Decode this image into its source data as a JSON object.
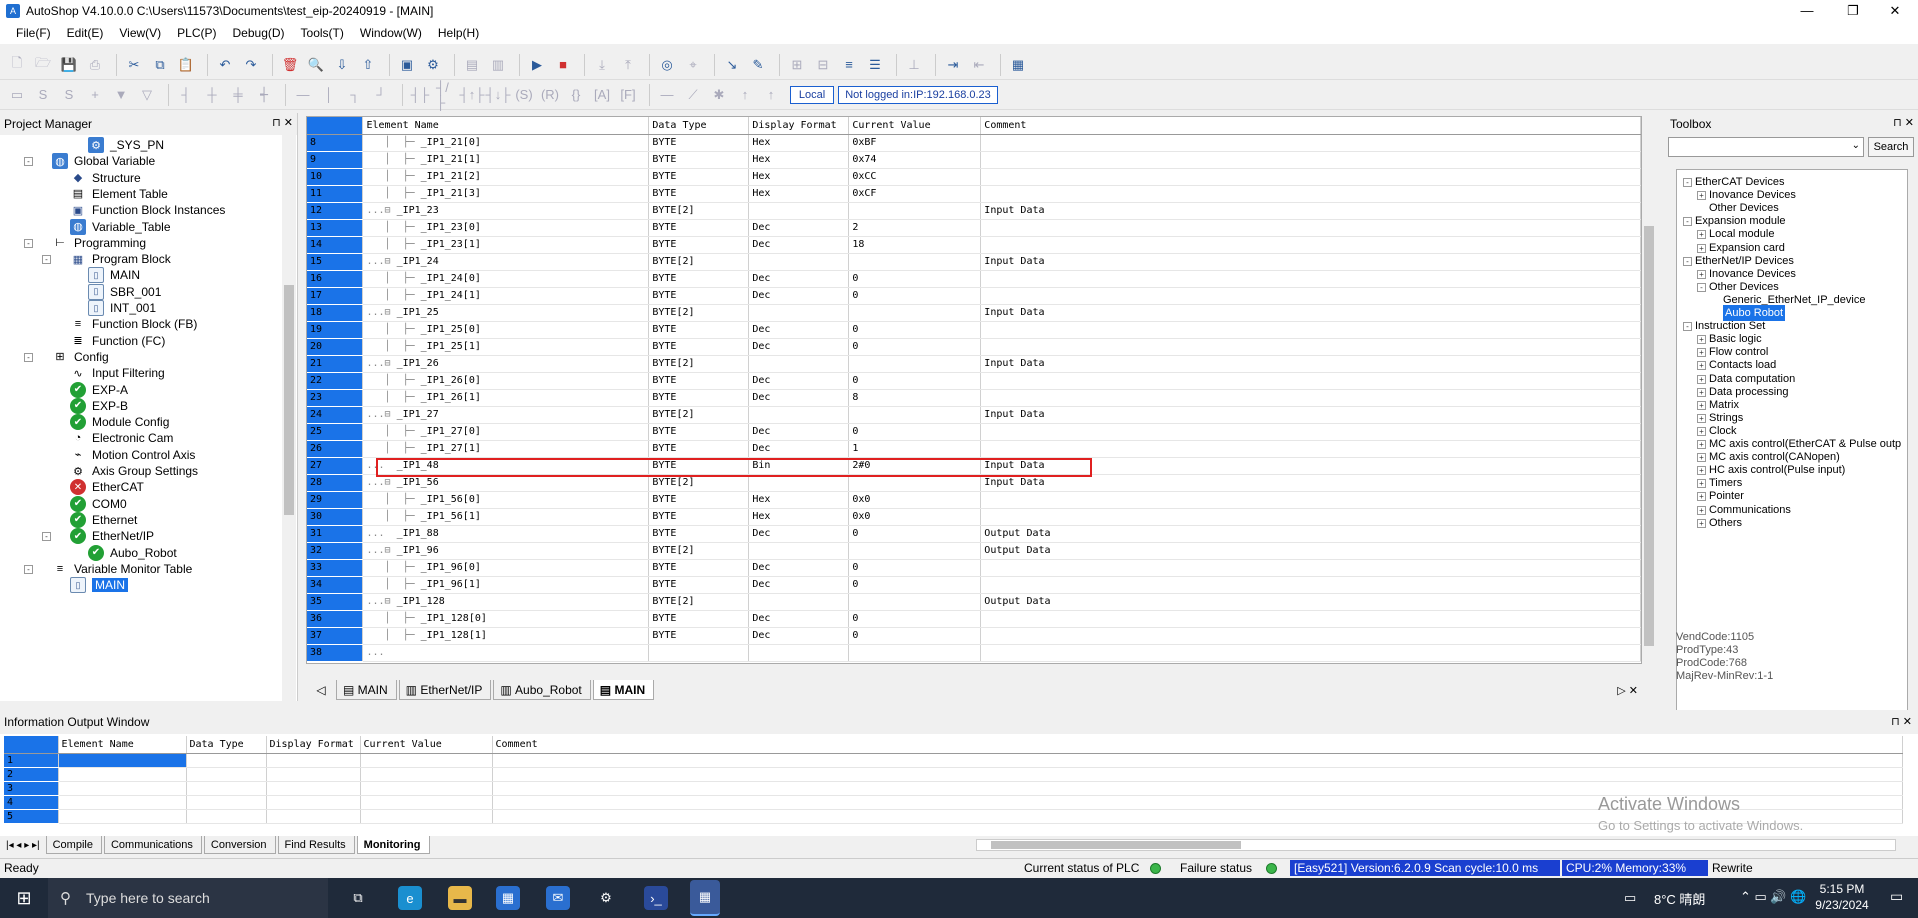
{
  "window": {
    "title": "AutoShop V4.10.0.0  C:\\Users\\11573\\Documents\\test_eip-20240919 - [MAIN]"
  },
  "menu": [
    "File(F)",
    "Edit(E)",
    "View(V)",
    "PLC(P)",
    "Debug(D)",
    "Tools(T)",
    "Window(W)",
    "Help(H)"
  ],
  "toolbar": {
    "local_label": "Local",
    "login_status": "Not logged in:IP:192.168.0.23"
  },
  "project_manager": {
    "title": "Project Manager",
    "items": [
      {
        "label": "_SYS_PN",
        "icon": "gear-blue-icon",
        "level": 3
      },
      {
        "label": "Global Variable",
        "icon": "globe-icon",
        "level": 1,
        "expander": "-"
      },
      {
        "label": "Structure",
        "icon": "structure-icon",
        "level": 2
      },
      {
        "label": "Element Table",
        "icon": "table-icon",
        "level": 2
      },
      {
        "label": "Function Block Instances",
        "icon": "cube-icon",
        "level": 2
      },
      {
        "label": "Variable_Table",
        "icon": "globe-icon",
        "level": 2
      },
      {
        "label": "Programming",
        "icon": "programming-icon",
        "level": 1,
        "expander": "-"
      },
      {
        "label": "Program Block",
        "icon": "grid-icon",
        "level": 2,
        "expander": "-"
      },
      {
        "label": "MAIN",
        "icon": "doc-icon",
        "level": 3
      },
      {
        "label": "SBR_001",
        "icon": "doc-icon",
        "level": 3
      },
      {
        "label": "INT_001",
        "icon": "doc-icon",
        "level": 3
      },
      {
        "label": "Function Block (FB)",
        "icon": "fb-icon",
        "level": 2
      },
      {
        "label": "Function (FC)",
        "icon": "fc-icon",
        "level": 2
      },
      {
        "label": "Config",
        "icon": "config-icon",
        "level": 1,
        "expander": "-"
      },
      {
        "label": "Input Filtering",
        "icon": "filter-icon",
        "level": 2
      },
      {
        "label": "EXP-A",
        "icon": "check-icon",
        "level": 2
      },
      {
        "label": "EXP-B",
        "icon": "check-icon",
        "level": 2
      },
      {
        "label": "Module Config",
        "icon": "check-icon",
        "level": 2
      },
      {
        "label": "Electronic Cam",
        "icon": "cam-icon",
        "level": 2
      },
      {
        "label": "Motion Control Axis",
        "icon": "axis-icon",
        "level": 2
      },
      {
        "label": "Axis Group Settings",
        "icon": "gear-icon",
        "level": 2
      },
      {
        "label": "EtherCAT",
        "icon": "error-icon",
        "level": 2
      },
      {
        "label": "COM0",
        "icon": "check-icon",
        "level": 2
      },
      {
        "label": "Ethernet",
        "icon": "check-icon",
        "level": 2
      },
      {
        "label": "EtherNet/IP",
        "icon": "check-icon",
        "level": 2,
        "expander": "-"
      },
      {
        "label": "Aubo_Robot",
        "icon": "check-icon",
        "level": 3
      },
      {
        "label": "Variable Monitor Table",
        "icon": "monitor-icon",
        "level": 1,
        "expander": "-"
      },
      {
        "label": "MAIN",
        "icon": "doc-icon",
        "level": 2,
        "selected": true
      }
    ]
  },
  "monitor_table": {
    "headers": [
      "",
      "Element Name",
      "Data Type",
      "Display Format",
      "Current Value",
      "Comment"
    ],
    "rows": [
      {
        "n": "8",
        "name": "_IP1_21[0]",
        "type": "BYTE",
        "fmt": "Hex",
        "val": "0xBF",
        "comment": "",
        "lvl": 2
      },
      {
        "n": "9",
        "name": "_IP1_21[1]",
        "type": "BYTE",
        "fmt": "Hex",
        "val": "0x74",
        "comment": "",
        "lvl": 2
      },
      {
        "n": "10",
        "name": "_IP1_21[2]",
        "type": "BYTE",
        "fmt": "Hex",
        "val": "0xCC",
        "comment": "",
        "lvl": 2
      },
      {
        "n": "11",
        "name": "_IP1_21[3]",
        "type": "BYTE",
        "fmt": "Hex",
        "val": "0xCF",
        "comment": "",
        "lvl": 2
      },
      {
        "n": "12",
        "name": "_IP1_23",
        "type": "BYTE[2]",
        "fmt": "",
        "val": "",
        "comment": "Input Data",
        "lvl": 1
      },
      {
        "n": "13",
        "name": "_IP1_23[0]",
        "type": "BYTE",
        "fmt": "Dec",
        "val": "2",
        "comment": "",
        "lvl": 2
      },
      {
        "n": "14",
        "name": "_IP1_23[1]",
        "type": "BYTE",
        "fmt": "Dec",
        "val": "18",
        "comment": "",
        "lvl": 2
      },
      {
        "n": "15",
        "name": "_IP1_24",
        "type": "BYTE[2]",
        "fmt": "",
        "val": "",
        "comment": "Input Data",
        "lvl": 1
      },
      {
        "n": "16",
        "name": "_IP1_24[0]",
        "type": "BYTE",
        "fmt": "Dec",
        "val": "0",
        "comment": "",
        "lvl": 2
      },
      {
        "n": "17",
        "name": "_IP1_24[1]",
        "type": "BYTE",
        "fmt": "Dec",
        "val": "0",
        "comment": "",
        "lvl": 2
      },
      {
        "n": "18",
        "name": "_IP1_25",
        "type": "BYTE[2]",
        "fmt": "",
        "val": "",
        "comment": "Input Data",
        "lvl": 1
      },
      {
        "n": "19",
        "name": "_IP1_25[0]",
        "type": "BYTE",
        "fmt": "Dec",
        "val": "0",
        "comment": "",
        "lvl": 2
      },
      {
        "n": "20",
        "name": "_IP1_25[1]",
        "type": "BYTE",
        "fmt": "Dec",
        "val": "0",
        "comment": "",
        "lvl": 2
      },
      {
        "n": "21",
        "name": "_IP1_26",
        "type": "BYTE[2]",
        "fmt": "",
        "val": "",
        "comment": "Input Data",
        "lvl": 1
      },
      {
        "n": "22",
        "name": "_IP1_26[0]",
        "type": "BYTE",
        "fmt": "Dec",
        "val": "0",
        "comment": "",
        "lvl": 2
      },
      {
        "n": "23",
        "name": "_IP1_26[1]",
        "type": "BYTE",
        "fmt": "Dec",
        "val": "8",
        "comment": "",
        "lvl": 2
      },
      {
        "n": "24",
        "name": "_IP1_27",
        "type": "BYTE[2]",
        "fmt": "",
        "val": "",
        "comment": "Input Data",
        "lvl": 1
      },
      {
        "n": "25",
        "name": "_IP1_27[0]",
        "type": "BYTE",
        "fmt": "Dec",
        "val": "0",
        "comment": "",
        "lvl": 2
      },
      {
        "n": "26",
        "name": "_IP1_27[1]",
        "type": "BYTE",
        "fmt": "Dec",
        "val": "1",
        "comment": "",
        "lvl": 2
      },
      {
        "n": "27",
        "name": "_IP1_48",
        "type": "BYTE",
        "fmt": "Bin",
        "val": "2#0",
        "comment": "Input Data",
        "lvl": 0
      },
      {
        "n": "28",
        "name": "_IP1_56",
        "type": "BYTE[2]",
        "fmt": "",
        "val": "",
        "comment": "Input Data",
        "lvl": 1
      },
      {
        "n": "29",
        "name": "_IP1_56[0]",
        "type": "BYTE",
        "fmt": "Hex",
        "val": "0x0",
        "comment": "",
        "lvl": 2
      },
      {
        "n": "30",
        "name": "_IP1_56[1]",
        "type": "BYTE",
        "fmt": "Hex",
        "val": "0x0",
        "comment": "",
        "lvl": 2
      },
      {
        "n": "31",
        "name": "_IP1_88",
        "type": "BYTE",
        "fmt": "Dec",
        "val": "0",
        "comment": "Output Data",
        "lvl": 0
      },
      {
        "n": "32",
        "name": "_IP1_96",
        "type": "BYTE[2]",
        "fmt": "",
        "val": "",
        "comment": "Output Data",
        "lvl": 1
      },
      {
        "n": "33",
        "name": "_IP1_96[0]",
        "type": "BYTE",
        "fmt": "Dec",
        "val": "0",
        "comment": "",
        "lvl": 2
      },
      {
        "n": "34",
        "name": "_IP1_96[1]",
        "type": "BYTE",
        "fmt": "Dec",
        "val": "0",
        "comment": "",
        "lvl": 2
      },
      {
        "n": "35",
        "name": "_IP1_128",
        "type": "BYTE[2]",
        "fmt": "",
        "val": "",
        "comment": "Output Data",
        "lvl": 1
      },
      {
        "n": "36",
        "name": "_IP1_128[0]",
        "type": "BYTE",
        "fmt": "Dec",
        "val": "0",
        "comment": "",
        "lvl": 2
      },
      {
        "n": "37",
        "name": "_IP1_128[1]",
        "type": "BYTE",
        "fmt": "Dec",
        "val": "0",
        "comment": "",
        "lvl": 2
      },
      {
        "n": "38",
        "name": "",
        "type": "",
        "fmt": "",
        "val": "",
        "comment": "",
        "lvl": -1
      }
    ]
  },
  "editor_tabs": [
    "MAIN",
    "EtherNet/IP",
    "Aubo_Robot",
    "MAIN"
  ],
  "toolbox": {
    "title": "Toolbox",
    "search_label": "Search",
    "items": [
      {
        "label": "EtherCAT Devices",
        "lvl": 0,
        "exp": "-"
      },
      {
        "label": "Inovance Devices",
        "lvl": 1,
        "exp": "+"
      },
      {
        "label": "Other Devices",
        "lvl": 1
      },
      {
        "label": "Expansion module",
        "lvl": 0,
        "exp": "-"
      },
      {
        "label": "Local module",
        "lvl": 1,
        "exp": "+"
      },
      {
        "label": "Expansion card",
        "lvl": 1,
        "exp": "+"
      },
      {
        "label": "EtherNet/IP Devices",
        "lvl": 0,
        "exp": "-"
      },
      {
        "label": "Inovance Devices",
        "lvl": 1,
        "exp": "+"
      },
      {
        "label": "Other Devices",
        "lvl": 1,
        "exp": "-"
      },
      {
        "label": "Generic_EtherNet_IP_device",
        "lvl": 2
      },
      {
        "label": "Aubo Robot",
        "lvl": 2,
        "selected": true
      },
      {
        "label": "Instruction Set",
        "lvl": 0,
        "exp": "-"
      },
      {
        "label": "Basic logic",
        "lvl": 1,
        "exp": "+"
      },
      {
        "label": "Flow control",
        "lvl": 1,
        "exp": "+"
      },
      {
        "label": "Contacts load",
        "lvl": 1,
        "exp": "+"
      },
      {
        "label": "Data computation",
        "lvl": 1,
        "exp": "+"
      },
      {
        "label": "Data processing",
        "lvl": 1,
        "exp": "+"
      },
      {
        "label": "Matrix",
        "lvl": 1,
        "exp": "+"
      },
      {
        "label": "Strings",
        "lvl": 1,
        "exp": "+"
      },
      {
        "label": "Clock",
        "lvl": 1,
        "exp": "+"
      },
      {
        "label": "MC axis control(EtherCAT & Pulse outp",
        "lvl": 1,
        "exp": "+"
      },
      {
        "label": "MC axis control(CANopen)",
        "lvl": 1,
        "exp": "+"
      },
      {
        "label": "HC axis control(Pulse input)",
        "lvl": 1,
        "exp": "+"
      },
      {
        "label": "Timers",
        "lvl": 1,
        "exp": "+"
      },
      {
        "label": "Pointer",
        "lvl": 1,
        "exp": "+"
      },
      {
        "label": "Communications",
        "lvl": 1,
        "exp": "+"
      },
      {
        "label": "Others",
        "lvl": 1,
        "exp": "+"
      }
    ],
    "info": [
      "VendCode:1105",
      "ProdType:43",
      "ProdCode:768",
      "MajRev-MinRev:1-1"
    ]
  },
  "info_window": {
    "title": "Information Output Window",
    "headers": [
      "",
      "Element Name",
      "Data Type",
      "Display Format",
      "Current Value",
      "Comment"
    ],
    "rows": [
      "1",
      "2",
      "3",
      "4",
      "5"
    ],
    "tabs": [
      "Compile",
      "Communications",
      "Conversion",
      "Find Results",
      "Monitoring"
    ],
    "watermark_title": "Activate Windows",
    "watermark_sub": "Go to Settings to activate Windows."
  },
  "status_bar": {
    "ready": "Ready",
    "plc_status": "Current status of PLC",
    "failure_status": "Failure status",
    "version": "[Easy521] Version:6.2.0.9 Scan cycle:10.0 ms",
    "cpu": "CPU:2%  Memory:33%",
    "mode": "Rewrite"
  },
  "taskbar": {
    "search_placeholder": "Type here to search",
    "weather": "8°C  晴朗",
    "time": "5:15 PM",
    "date": "9/23/2024"
  },
  "colors": {
    "accent": "#1a73e8",
    "highlight_box": "#e02020",
    "ok": "#22a035",
    "error": "#d03030"
  }
}
